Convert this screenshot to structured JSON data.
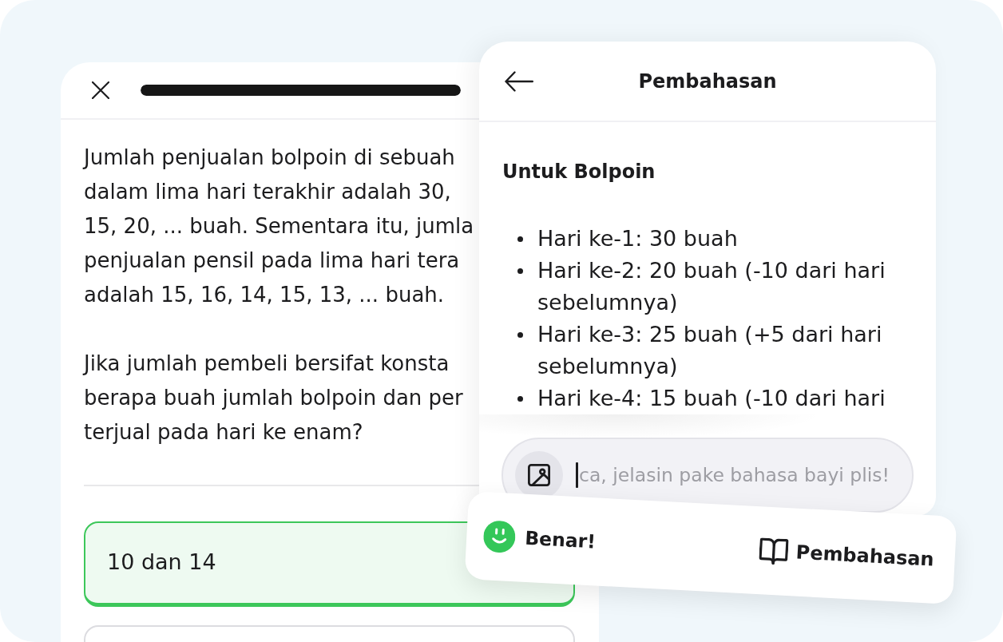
{
  "quiz": {
    "progress": {
      "level": 1
    },
    "question": {
      "paragraphs": [
        {
          "lines": [
            "Jumlah penjualan bolpoin di sebuah",
            "dalam lima hari terakhir adalah 30,",
            "15, 20, ... buah. Sementara itu, jumla",
            "penjualan pensil pada lima hari tera",
            "adalah 15, 16, 14, 15, 13, ... buah."
          ]
        },
        {
          "lines": [
            "Jika jumlah pembeli bersifat konsta",
            "berapa buah jumlah bolpoin dan per",
            "terjual pada hari ke enam?"
          ]
        }
      ]
    },
    "options": [
      {
        "label": "10 dan 14",
        "selected": true
      },
      {
        "selected": false
      }
    ]
  },
  "explanation_panel": {
    "title": "Pembahasan",
    "heading": "Untuk Bolpoin",
    "items": [
      "Hari ke-1: 30 buah",
      "Hari ke-2: 20 buah (-10 dari hari sebelumnya)",
      "Hari ke-3: 25 buah (+5 dari hari sebelumnya)",
      "Hari ke-4: 15 buah (-10 dari hari"
    ],
    "chat_input": {
      "placeholder": "ca, jelasin pake bahasa bayi plis!"
    }
  },
  "result_toast": {
    "status": "Benar!",
    "button": "Pembahasan"
  }
}
